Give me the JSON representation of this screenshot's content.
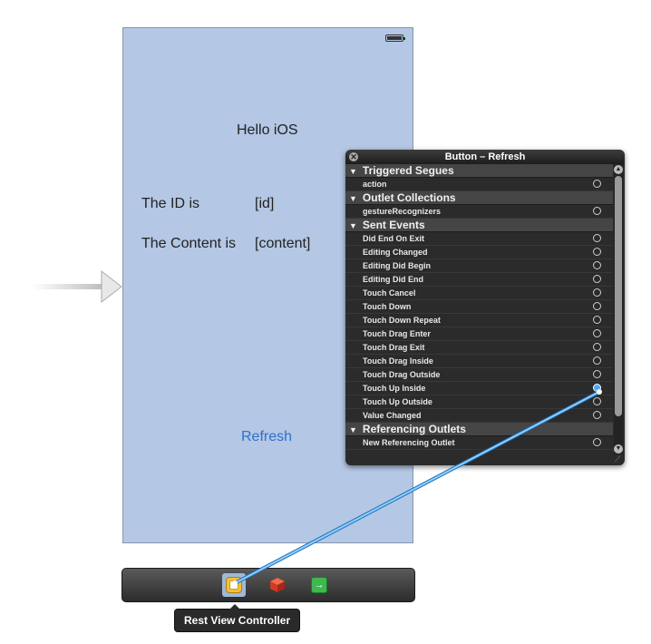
{
  "scene": {
    "title": "Hello iOS",
    "id_label": "The ID is",
    "id_value": "[id]",
    "content_label": "The Content is",
    "content_value": "[content]",
    "refresh_button": "Refresh"
  },
  "panel": {
    "title": "Button – Refresh",
    "sections": [
      {
        "label": "Triggered Segues",
        "items": [
          {
            "label": "action",
            "connected": false
          }
        ]
      },
      {
        "label": "Outlet Collections",
        "items": [
          {
            "label": "gestureRecognizers",
            "connected": false
          }
        ]
      },
      {
        "label": "Sent Events",
        "items": [
          {
            "label": "Did End On Exit",
            "connected": false
          },
          {
            "label": "Editing Changed",
            "connected": false
          },
          {
            "label": "Editing Did Begin",
            "connected": false
          },
          {
            "label": "Editing Did End",
            "connected": false
          },
          {
            "label": "Touch Cancel",
            "connected": false
          },
          {
            "label": "Touch Down",
            "connected": false
          },
          {
            "label": "Touch Down Repeat",
            "connected": false
          },
          {
            "label": "Touch Drag Enter",
            "connected": false
          },
          {
            "label": "Touch Drag Exit",
            "connected": false
          },
          {
            "label": "Touch Drag Inside",
            "connected": false
          },
          {
            "label": "Touch Drag Outside",
            "connected": false
          },
          {
            "label": "Touch Up Inside",
            "connected": true
          },
          {
            "label": "Touch Up Outside",
            "connected": false
          },
          {
            "label": "Value Changed",
            "connected": false
          }
        ]
      },
      {
        "label": "Referencing Outlets",
        "items": [
          {
            "label": "New Referencing Outlet",
            "connected": false
          }
        ]
      }
    ]
  },
  "dock": {
    "items": [
      {
        "name": "view-controller-icon",
        "selected": true
      },
      {
        "name": "first-responder-icon",
        "selected": false
      },
      {
        "name": "exit-icon",
        "selected": false
      }
    ],
    "tooltip": "Rest View Controller"
  },
  "colors": {
    "scene_background": "#b4c7e4",
    "accent_blue": "#2e6fcf",
    "panel_background": "#2b2b2b",
    "connection_wire": "#4aa8ff"
  }
}
